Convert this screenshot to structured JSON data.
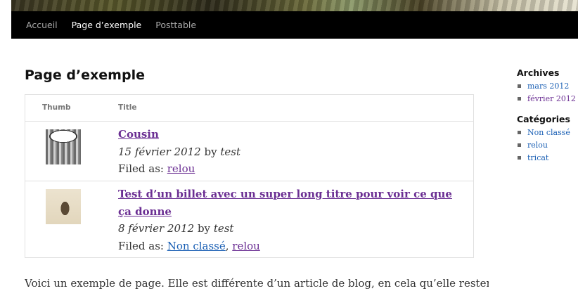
{
  "nav": {
    "items": [
      {
        "label": "Accueil",
        "current": false
      },
      {
        "label": "Page d’exemple",
        "current": true
      },
      {
        "label": "Posttable",
        "current": false
      }
    ]
  },
  "page": {
    "title": "Page d’exemple",
    "intro": "Voici un exemple de page. Elle est différente d’un article de blog, en cela qu’elle restera à la"
  },
  "listing": {
    "columns": {
      "thumb": "Thumb",
      "title": "Title"
    },
    "rows": [
      {
        "title": "Cousin",
        "date": "15 février 2012",
        "by": "by",
        "author": "test",
        "filed_label": "Filed as:",
        "categories": [
          "relou"
        ],
        "separator": ", "
      },
      {
        "title": "Test d’un billet avec un super long titre pour voir ce que ça donne",
        "date": "8 février 2012",
        "by": "by",
        "author": "test",
        "filed_label": "Filed as:",
        "categories": [
          "Non classé",
          "relou"
        ],
        "separator": ", "
      }
    ]
  },
  "sidebar": {
    "archives": {
      "title": "Archives",
      "items": [
        "mars 2012",
        "février 2012"
      ]
    },
    "categories": {
      "title": "Catégories",
      "items": [
        "Non classé",
        "relou",
        "tricat"
      ]
    }
  },
  "colors": {
    "nav_bg": "#000000",
    "link_visited": "#6b2f93",
    "link_unvisited": "#1a5fb4"
  },
  "icons": {
    "thumb_1": "comic-panel-thumbnail",
    "thumb_2": "horse-rider-thumbnail"
  }
}
